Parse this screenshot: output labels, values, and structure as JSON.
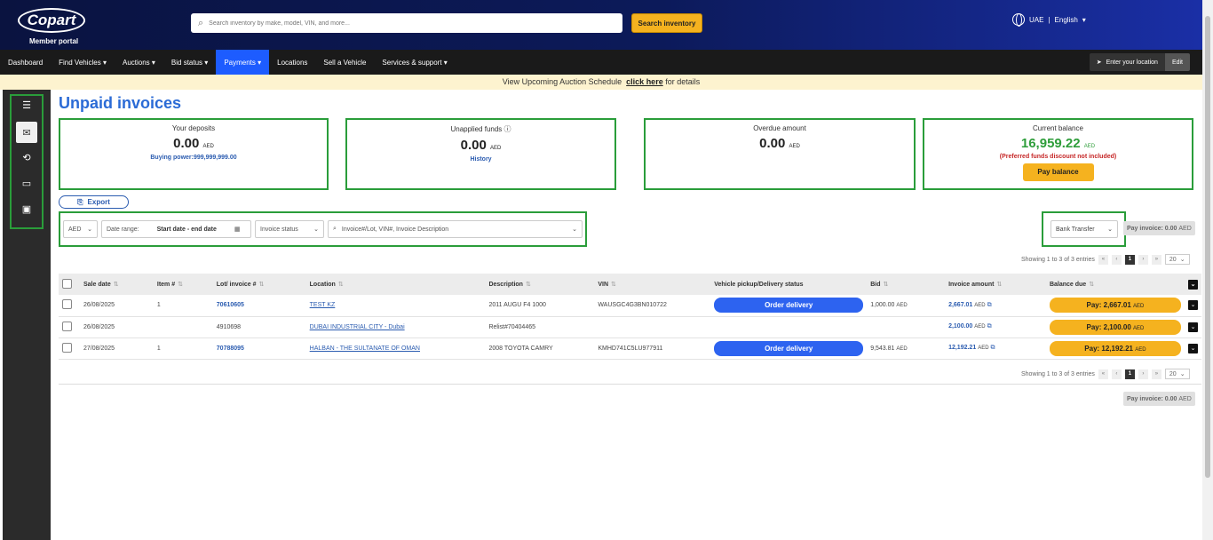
{
  "header": {
    "logo": "Copart",
    "logo_sub": "Member portal",
    "search_placeholder": "Search inventory by make, model, VIN, and more...",
    "search_button": "Search inventory",
    "country": "UAE",
    "separator": "|",
    "language": "English"
  },
  "nav": {
    "items": [
      "Dashboard",
      "Find Vehicles",
      "Auctions",
      "Bid status",
      "Payments",
      "Locations",
      "Sell a Vehicle",
      "Services & support"
    ],
    "location_label": "Enter your location",
    "edit_label": "Edit"
  },
  "banner": {
    "text": "View Upcoming Auction Schedule",
    "link": "click here",
    "suffix": "for details"
  },
  "page": {
    "title": "Unpaid invoices"
  },
  "cards": {
    "deposits": {
      "label": "Your deposits",
      "value": "0.00",
      "currency": "AED",
      "sub": "Buying power:999,999,999.00"
    },
    "unapplied": {
      "label": "Unapplied funds",
      "value": "0.00",
      "currency": "AED",
      "sub": "History"
    },
    "overdue": {
      "label": "Overdue amount",
      "value": "0.00",
      "currency": "AED"
    },
    "balance": {
      "label": "Current balance",
      "value": "16,959.22",
      "currency": "AED",
      "note": "(Preferred funds discount not included)",
      "button": "Pay balance"
    }
  },
  "toolbar": {
    "export": "Export",
    "currency": "AED",
    "date_label": "Date range:",
    "date_value": "Start date - end date",
    "status": "Invoice status",
    "search_placeholder": "Invoice#/Lot, VIN#, Invoice Description",
    "payment_method": "Bank Transfer",
    "pay_invoice": "Pay invoice: 0.00",
    "pay_invoice_currency": "AED"
  },
  "pager": {
    "info": "Showing 1 to 3 of 3 entries",
    "current": "1",
    "page_size": "20"
  },
  "table": {
    "headers": [
      "Sale date",
      "Item #",
      "Lot/ invoice #",
      "Location",
      "Description",
      "VIN",
      "Vehicle pickup/Delivery status",
      "Bid",
      "Invoice amount",
      "Balance due"
    ],
    "rows": [
      {
        "sale_date": "26/08/2025",
        "item": "1",
        "lot": "70610605",
        "location": "TEST KZ",
        "description": "2011 AUGU F4 1000",
        "vin": "WAUSGC4G3BN010722",
        "delivery": "Order delivery",
        "bid": "1,000.00",
        "invoice": "2,667.01",
        "balance": "Pay: 2,667.01"
      },
      {
        "sale_date": "26/08/2025",
        "item": "",
        "lot": "4910698",
        "location": "DUBAI INDUSTRIAL CITY - Dubai",
        "description": "Relist#70404465",
        "vin": "",
        "delivery": "",
        "bid": "",
        "invoice": "2,100.00",
        "balance": "Pay: 2,100.00"
      },
      {
        "sale_date": "27/08/2025",
        "item": "1",
        "lot": "70788095",
        "location": "HALBAN - THE SULTANATE OF OMAN",
        "description": "2008 TOYOTA CAMRY",
        "vin": "KMHD741C5LU977911",
        "delivery": "Order delivery",
        "bid": "9,543.81",
        "invoice": "12,192.21",
        "balance": "Pay: 12,192.21"
      }
    ],
    "currency": "AED"
  },
  "colors": {
    "accent": "#2b6bd6",
    "brand_yellow": "#f5b21f",
    "highlight_green": "#2a9d3a",
    "positive": "#2f9e3b"
  }
}
